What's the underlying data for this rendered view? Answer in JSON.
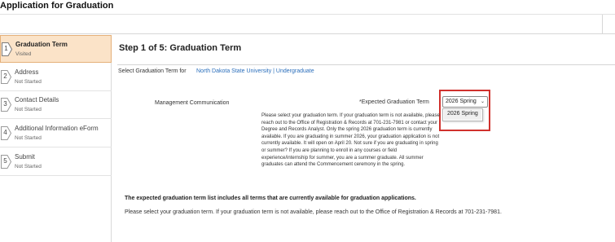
{
  "app": {
    "title": "Application for Graduation"
  },
  "steps": [
    {
      "number": "1",
      "title": "Graduation Term",
      "status": "Visited",
      "active": true
    },
    {
      "number": "2",
      "title": "Address",
      "status": "Not Started",
      "active": false
    },
    {
      "number": "3",
      "title": "Contact Details",
      "status": "Not Started",
      "active": false
    },
    {
      "number": "4",
      "title": "Additional Information eForm",
      "status": "Not Started",
      "active": false
    },
    {
      "number": "5",
      "title": "Submit",
      "status": "Not Started",
      "active": false
    }
  ],
  "main": {
    "heading": "Step 1 of 5: Graduation Term",
    "select_label": "Select Graduation Term for",
    "institution_link": "North Dakota State University | Undergraduate",
    "program": "Management Communication",
    "expected_label": "*Expected Graduation Term",
    "selected_term": "2026 Spring",
    "options": [
      "2026 Spring"
    ],
    "help_text": "Please select your graduation term. If your graduation term is not available, please reach out to the Office of Registration & Records at 701-231-7981 or contact your Degree and Records Analyst. Only the spring 2026 graduation term is currently available. If you are graduating in summer 2026, your graduation application is not currently available. It will open on April 20. Not sure if you are graduating in spring or summer? If you are planning to enroll in any courses or field experience/internship for summer, you are a summer graduate. All summer graduates can attend the Commencement ceremony in the spring.",
    "note_bold": "The expected graduation term list includes all terms that are currently available for graduation applications.",
    "note_plain": "Please select your graduation term. If your graduation term is not available, please reach out to the Office of Registration & Records at 701-231-7981."
  },
  "colors": {
    "active_step_bg": "#fbe3c8",
    "highlight_border": "#d0312d",
    "link": "#2a6ebb"
  }
}
